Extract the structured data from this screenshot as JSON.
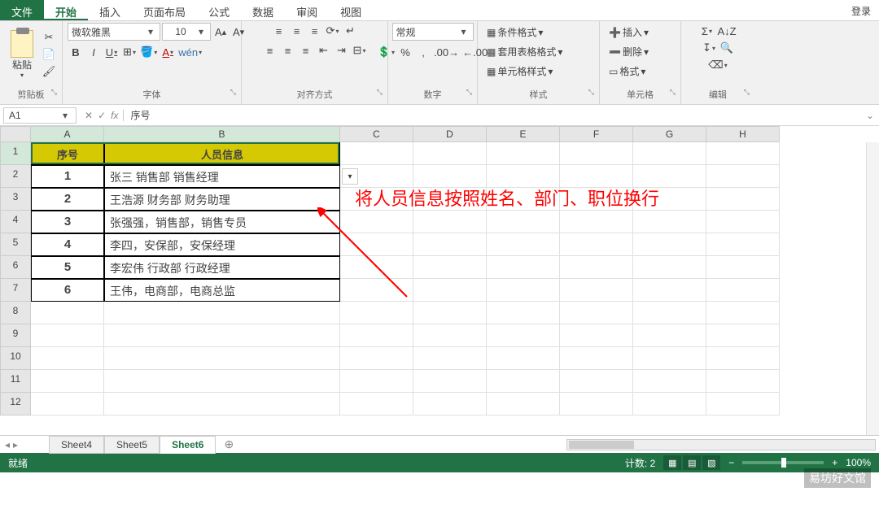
{
  "menu": {
    "file": "文件",
    "tabs": [
      "开始",
      "插入",
      "页面布局",
      "公式",
      "数据",
      "审阅",
      "视图"
    ],
    "login": "登录",
    "active": 0
  },
  "ribbon": {
    "clipboard": {
      "paste": "粘贴",
      "label": "剪贴板"
    },
    "font": {
      "name": "微软雅黑",
      "size": "10",
      "bold": "B",
      "italic": "I",
      "underline": "U",
      "wen": "wén",
      "label": "字体"
    },
    "align": {
      "label": "对齐方式"
    },
    "number": {
      "format": "常规",
      "label": "数字"
    },
    "styles": {
      "cond": "条件格式",
      "table": "套用表格格式",
      "cell": "单元格样式",
      "label": "样式"
    },
    "cells": {
      "insert": "插入",
      "delete": "删除",
      "format": "格式",
      "label": "单元格"
    },
    "editing": {
      "label": "编辑"
    }
  },
  "formula": {
    "namebox": "A1",
    "fx": "序号"
  },
  "columns": [
    "A",
    "B",
    "C",
    "D",
    "E",
    "F",
    "G",
    "H"
  ],
  "header_row": {
    "A": "序号",
    "B": "人员信息"
  },
  "data_rows": [
    {
      "n": "1",
      "info": "张三 销售部 销售经理"
    },
    {
      "n": "2",
      "info": "王浩源 财务部 财务助理"
    },
    {
      "n": "3",
      "info": "张强强，销售部，销售专员"
    },
    {
      "n": "4",
      "info": "李四，安保部，安保经理"
    },
    {
      "n": "5",
      "info": "李宏伟 行政部 行政经理"
    },
    {
      "n": "6",
      "info": "王伟，电商部，电商总监"
    }
  ],
  "annotation": "将人员信息按照姓名、部门、职位换行",
  "sheets": {
    "list": [
      "Sheet4",
      "Sheet5",
      "Sheet6"
    ],
    "active": 2
  },
  "status": {
    "ready": "就绪",
    "count_label": "计数:",
    "count": "2",
    "zoom": "100%"
  },
  "watermark": "易坊好文馆"
}
